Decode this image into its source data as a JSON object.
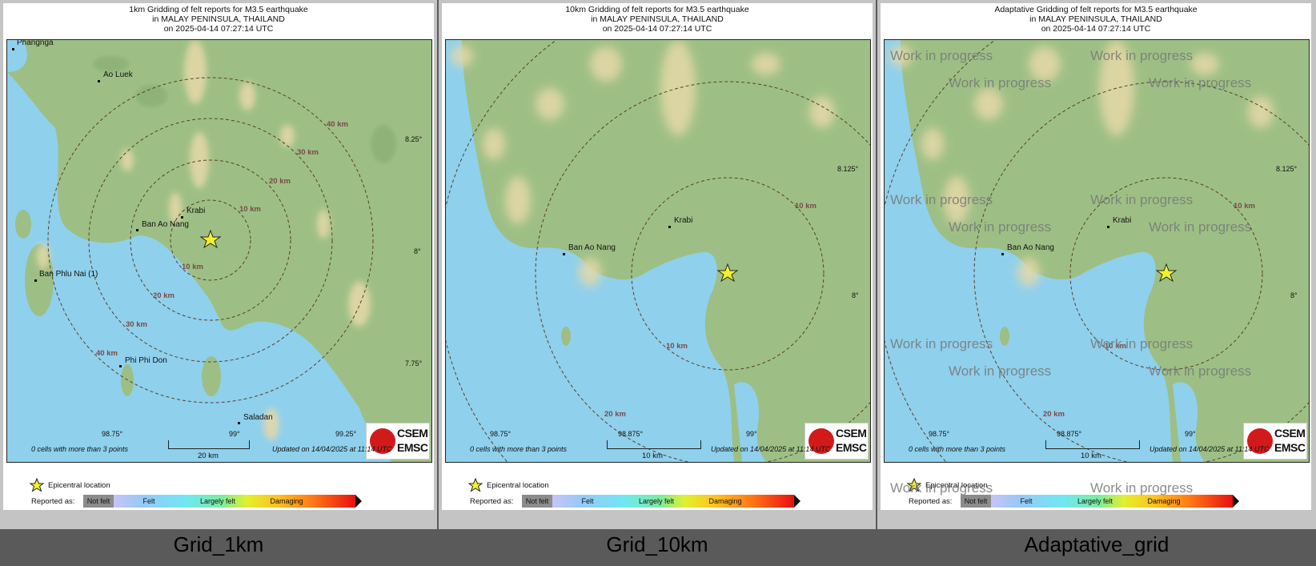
{
  "panels": [
    {
      "id": "grid1",
      "title_lines": [
        "1km Gridding of felt reports for M3.5 earthquake",
        "in MALAY PENINSULA, THAILAND",
        "on  2025-04-14 07:27:14 UTC"
      ],
      "caption": "Grid_1km",
      "footer_cells": "0 cells with more than 3 points",
      "footer_updated": "Updated on 14/04/2025 at 11:14 UTC",
      "scale_label": "20 km",
      "lat_labels": [
        "8.25°",
        "8°",
        "7.75°"
      ],
      "lon_labels": [
        "98.75°",
        "99°",
        "99.25°"
      ],
      "places": [
        "Phangnga",
        "Ao Luek",
        "Krabi",
        "Ban Ao Nang",
        "Ban Phlu Nai (1)",
        "Phi Phi Don",
        "Saladan"
      ],
      "ring_labels": [
        "10 km",
        "10 km",
        "20 km",
        "20 km",
        "30 km",
        "30 km",
        "40 km",
        "40 km"
      ]
    },
    {
      "id": "grid10",
      "title_lines": [
        "10km Gridding of felt reports for M3.5 earthquake",
        "in MALAY PENINSULA, THAILAND",
        "on  2025-04-14 07:27:14 UTC"
      ],
      "caption": "Grid_10km",
      "footer_cells": "0 cells with more than 3 points",
      "footer_updated": "Updated on 14/04/2025 at 11:14 UTC",
      "scale_label": "10 km",
      "lat_labels": [
        "8.125°",
        "8°"
      ],
      "lon_labels": [
        "98.75°",
        "98.875°",
        "99°"
      ],
      "places": [
        "Krabi",
        "Ban Ao Nang"
      ],
      "ring_labels": [
        "10 km",
        "10 km",
        "20 km"
      ]
    },
    {
      "id": "adaptive",
      "title_lines": [
        "Adaptative Gridding of felt reports for M3.5 earthquake",
        "in MALAY PENINSULA, THAILAND",
        "on  2025-04-14 07:27:14 UTC"
      ],
      "caption": "Adaptative_grid",
      "footer_cells": "0 cells with more than 3 points",
      "footer_updated": "Updated on 14/04/2025 at 11:14 UTC",
      "scale_label": "10 km",
      "lat_labels": [
        "8.125°",
        "8°"
      ],
      "lon_labels": [
        "98.75°",
        "98.875°",
        "99°"
      ],
      "places": [
        "Krabi",
        "Ban Ao Nang"
      ],
      "ring_labels": [
        "10 km",
        "10 km",
        "20 km"
      ],
      "watermark": "Work in progress"
    }
  ],
  "legend": {
    "epicentral": "Epicentral location",
    "reported_as": "Reported as:",
    "scale": [
      "Not felt",
      "Felt",
      "Largely felt",
      "Damaging"
    ]
  },
  "logo": {
    "line1": "CSEM",
    "line2": "EMSC"
  },
  "colors": {
    "sea": "#8fd0ec",
    "land": "#9dbf85",
    "relief": "#e6d9a8",
    "ring": "#5a3f2b",
    "star": "#f2f22a"
  }
}
